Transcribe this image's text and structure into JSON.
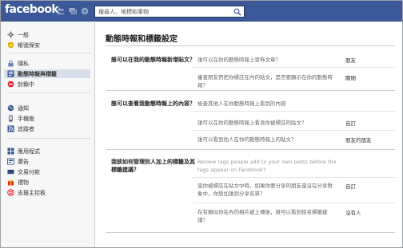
{
  "topbar": {
    "logo": "facebook",
    "search_placeholder": "搜尋人、地標和事物",
    "jewels": [
      "friends-icon",
      "messages-icon",
      "notifications-icon"
    ],
    "colors": {
      "bar": "#3b5998"
    }
  },
  "sidebar": {
    "groups": [
      {
        "items": [
          {
            "label": "一般",
            "icon": "gear-icon"
          },
          {
            "label": "帳號保安",
            "icon": "shield-icon"
          }
        ]
      },
      {
        "items": [
          {
            "label": "隱私",
            "icon": "lock-icon"
          },
          {
            "label": "動態時報與標籤",
            "icon": "timeline-icon",
            "active": true
          },
          {
            "label": "封鎖中",
            "icon": "block-icon"
          }
        ]
      },
      {
        "items": [
          {
            "label": "通知",
            "icon": "globe-icon"
          },
          {
            "label": "手機版",
            "icon": "mobile-icon"
          },
          {
            "label": "追蹤者",
            "icon": "rss-icon"
          }
        ]
      },
      {
        "items": [
          {
            "label": "應用程式",
            "icon": "apps-icon"
          },
          {
            "label": "廣告",
            "icon": "ads-icon"
          },
          {
            "label": "交易付款",
            "icon": "payments-icon"
          },
          {
            "label": "禮物",
            "icon": "gift-icon"
          },
          {
            "label": "支援主控板",
            "icon": "support-icon"
          }
        ]
      }
    ]
  },
  "main": {
    "title": "動態時報和標籤設定",
    "sections": [
      {
        "question": "誰可以在我的動態時報新增貼文？",
        "rows": [
          {
            "text": "誰可以在你的動態時報上發佈文章？",
            "value": "朋友"
          },
          {
            "text": "審查朋友們把你標註在內的貼文，是否要顯示在你的動態時報？",
            "value": "關閉"
          }
        ]
      },
      {
        "question": "誰可以查看我動態時報上的內容？",
        "rows": [
          {
            "text": "檢查其他人在你動態時報上看到的內容",
            "value": ""
          },
          {
            "text": "誰可以在你的動態時報上看見你被標註的貼文？",
            "value": "自訂"
          },
          {
            "text": "誰可以看到他人在你的動態時報上的貼文？",
            "value": "朋友的朋友"
          }
        ]
      },
      {
        "question": "我該如何管理別人加上的標籤及其標籤建議？",
        "rows": [
          {
            "text": "Review tags people add to your own posts before the tags appear on Facebook?",
            "value": "",
            "dim": true
          },
          {
            "text": "當你被標註在貼文中時，如果你要分享的朋友還沒在分享對象中，你想加誰到分享名單？",
            "value": "自訂"
          },
          {
            "text": "在有類似你在內的相片被上傳後，誰可以看到姓名標籤建議？",
            "value": "沒有人"
          }
        ]
      }
    ]
  }
}
